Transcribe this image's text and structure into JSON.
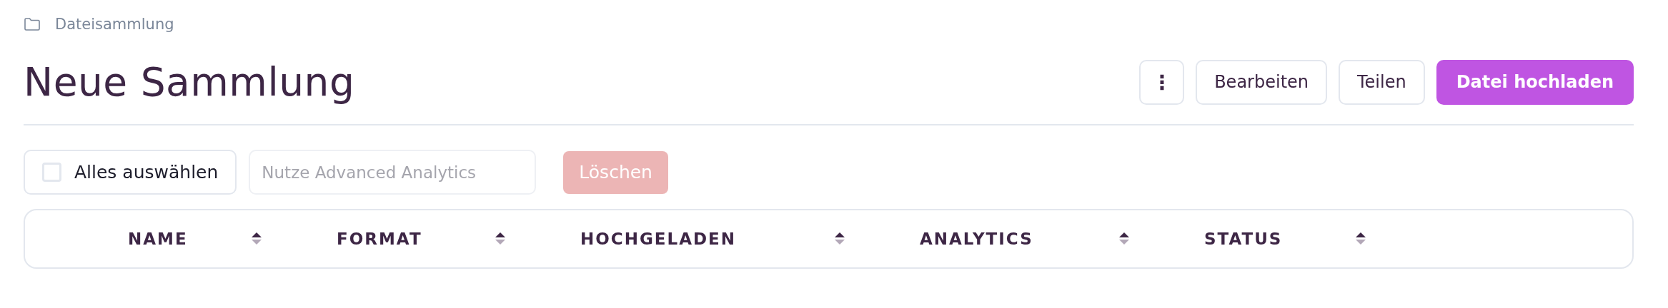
{
  "breadcrumb": {
    "label": "Dateisammlung"
  },
  "title": "Neue Sammlung",
  "actions": [
    {
      "kind": "menu",
      "label": "⋮"
    },
    {
      "kind": "secondary",
      "label": "Bearbeiten"
    },
    {
      "kind": "secondary",
      "label": "Teilen"
    },
    {
      "kind": "primary",
      "label": "Datei hochladen"
    }
  ],
  "toolbar": {
    "select_all": {
      "label": "Alles auswählen",
      "checked": false
    },
    "analytics_field": {
      "placeholder": "Nutze Advanced Analytics"
    },
    "delete_button": {
      "label": "Löschen",
      "disabled": true
    }
  },
  "table": {
    "columns": [
      {
        "label": "NAME"
      },
      {
        "label": "FORMAT"
      },
      {
        "label": "HOCHGELADEN"
      },
      {
        "label": "ANALYTICS"
      },
      {
        "label": "STATUS"
      }
    ]
  }
}
